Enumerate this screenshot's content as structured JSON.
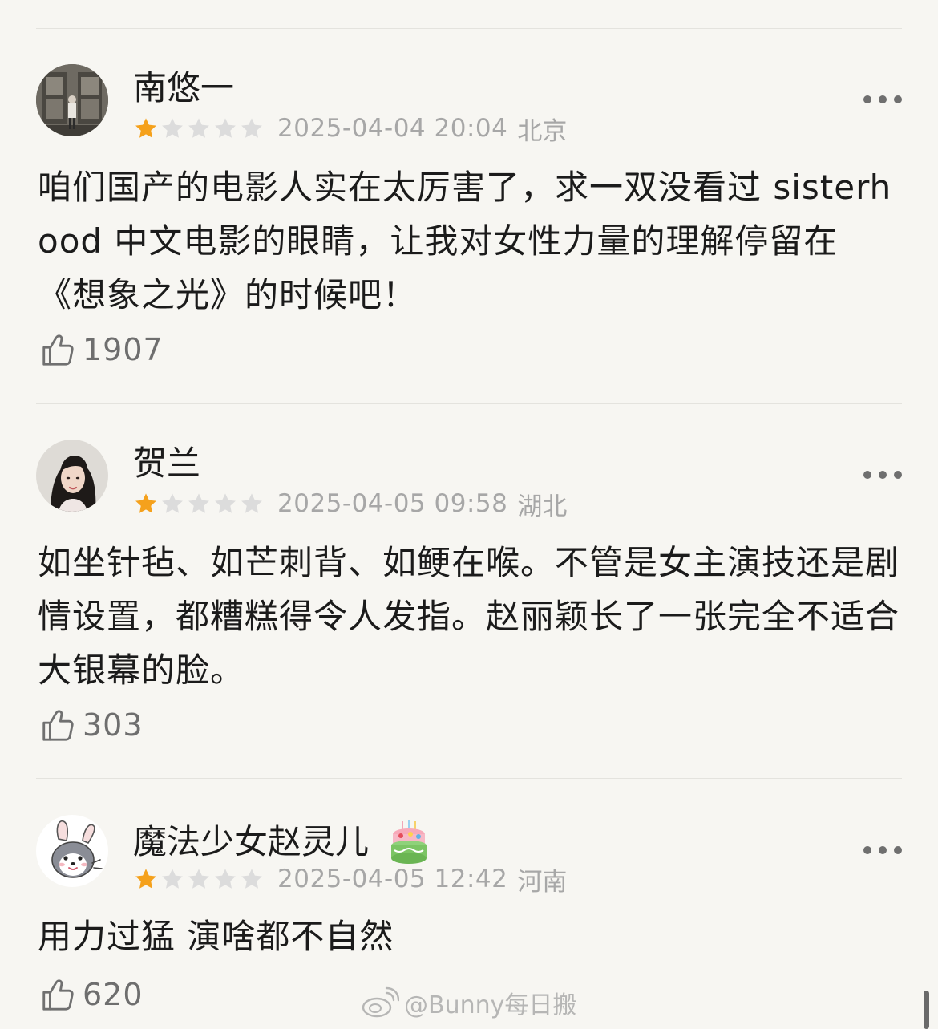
{
  "reviews": [
    {
      "username": "南悠一",
      "rating": 1,
      "max_rating": 5,
      "date": "2025-04-04 20:04",
      "location": "北京",
      "content": "咱们国产的电影人实在太厉害了，求一双没看过 sisterhood 中文电影的眼睛，让我对女性力量的理解停留在《想象之光》的时候吧！",
      "likes": "1907",
      "avatar_icon": "person-standing-photo-icon"
    },
    {
      "username": "贺兰",
      "rating": 1,
      "max_rating": 5,
      "date": "2025-04-05 09:58",
      "location": "湖北",
      "content": "如坐针毡、如芒刺背、如鲠在喉。不管是女主演技还是剧情设置，都糟糕得令人发指。赵丽颖长了一张完全不适合大银幕的脸。",
      "likes": "303",
      "avatar_icon": "woman-portrait-icon"
    },
    {
      "username": "魔法少女赵灵儿",
      "rating": 1,
      "max_rating": 5,
      "date": "2025-04-05 12:42",
      "location": "河南",
      "content": "用力过猛 演啥都不自然",
      "likes": "620",
      "avatar_icon": "cartoon-husky-bunny-ears-icon",
      "badge_icon": "birthday-cake-icon"
    }
  ],
  "watermark": {
    "text": "@Bunny每日搬",
    "icon": "weibo-logo-icon"
  },
  "colors": {
    "background": "#f7f6f2",
    "star_filled": "#f5a11c",
    "star_empty": "#dcdcdc",
    "meta_text": "#a7a7a7",
    "divider": "#e4e3de"
  }
}
